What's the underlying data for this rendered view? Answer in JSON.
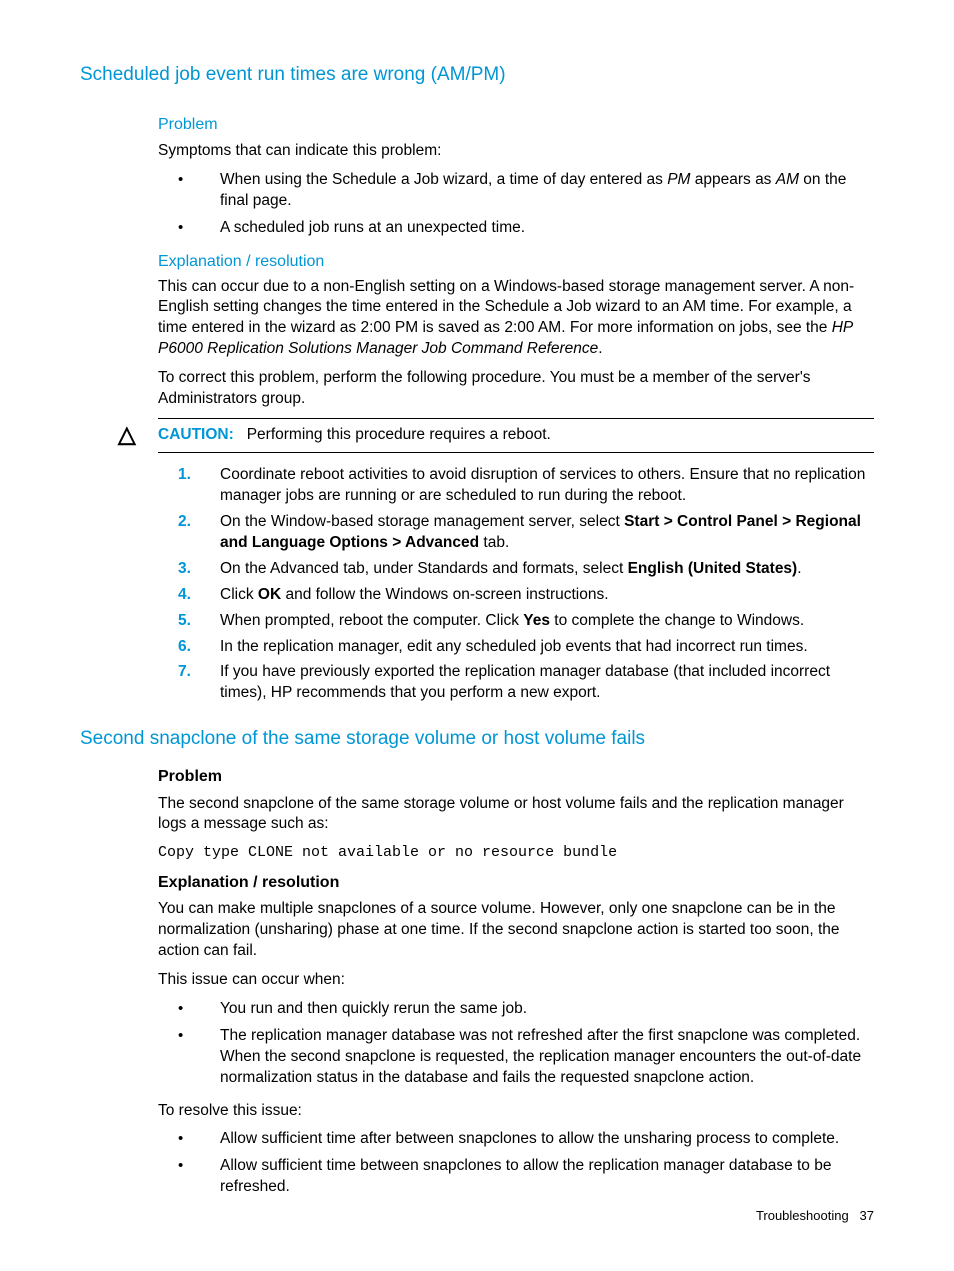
{
  "section1": {
    "title": "Scheduled job event run times are wrong (AM/PM)",
    "problem_label": "Problem",
    "symptoms_intro": "Symptoms that can indicate this problem:",
    "symptom1_pre": "When using the Schedule a Job wizard, a time of day entered as ",
    "symptom1_pm": "PM",
    "symptom1_mid": " appears as ",
    "symptom1_am": "AM",
    "symptom1_post": " on the final page.",
    "symptom2": "A scheduled job runs at an unexpected time.",
    "explanation_label": "Explanation / resolution",
    "explanation_p1_pre": "This can occur due to a non-English setting on a Windows-based storage management server. A non-English setting changes the time entered in the Schedule a Job wizard to an AM time. For example, a time entered in the wizard as 2:00 PM is saved as 2:00 AM. For more information on jobs, see the ",
    "explanation_p1_ref": "HP P6000 Replication Solutions Manager Job Command Reference",
    "explanation_p1_post": ".",
    "explanation_p2": "To correct this problem, perform the following procedure. You must be a member of the server's Administrators group.",
    "caution_label": "CAUTION:",
    "caution_text": "Performing this procedure requires a reboot.",
    "steps": {
      "s1": "Coordinate reboot activities to avoid disruption of services to others. Ensure that no replication manager jobs are running or are scheduled to run during the reboot.",
      "s2_pre": "On the Window-based storage management server, select ",
      "s2_bold": "Start > Control Panel > Regional and Language Options > Advanced",
      "s2_post": " tab.",
      "s3_pre": "On the Advanced tab, under Standards and formats, select ",
      "s3_bold": "English (United States)",
      "s3_post": ".",
      "s4_pre": "Click ",
      "s4_bold": "OK",
      "s4_post": " and follow the Windows on-screen instructions.",
      "s5_pre": "When prompted, reboot the computer. Click ",
      "s5_bold": "Yes",
      "s5_post": " to complete the change to Windows.",
      "s6": "In the replication manager, edit any scheduled job events that had incorrect run times.",
      "s7": "If you have previously exported the replication manager database (that included incorrect times), HP recommends that you perform a new export."
    }
  },
  "section2": {
    "title": "Second snapclone of the same storage volume or host volume fails",
    "problem_label": "Problem",
    "problem_p1": "The second snapclone of the same storage volume or host volume fails and the replication manager logs a message such as:",
    "code": "Copy type CLONE not available or no resource bundle",
    "explanation_label": "Explanation / resolution",
    "explanation_p1": "You can make multiple snapclones of a source volume. However, only one snapclone can be in the normalization (unsharing) phase at one time. If the second snapclone action is started too soon, the action can fail.",
    "occur_intro": "This issue can occur when:",
    "occur1": "You run and then quickly rerun the same job.",
    "occur2": "The replication manager database was not refreshed after the first snapclone was completed. When the second snapclone is requested, the replication manager encounters the out-of-date normalization status in the database and fails the requested snapclone action.",
    "resolve_intro": "To resolve this issue:",
    "resolve1": "Allow sufficient time after between snapclones to allow the unsharing process to complete.",
    "resolve2": "Allow sufficient time between snapclones to allow the replication manager database to be refreshed."
  },
  "footer": {
    "category": "Troubleshooting",
    "page": "37"
  }
}
